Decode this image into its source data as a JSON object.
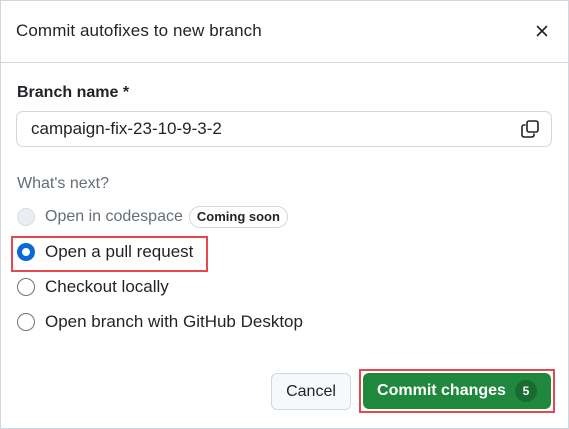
{
  "dialog": {
    "title": "Commit autofixes to new branch",
    "close_icon": "close-icon"
  },
  "branch": {
    "label": "Branch name *",
    "value": "campaign-fix-23-10-9-3-2",
    "copy_icon": "copy-icon"
  },
  "next": {
    "label": "What's next?",
    "options": [
      {
        "label": "Open in codespace",
        "badge": "Coming soon",
        "state": "disabled"
      },
      {
        "label": "Open a pull request",
        "state": "checked"
      },
      {
        "label": "Checkout locally",
        "state": "unchecked"
      },
      {
        "label": "Open branch with GitHub Desktop",
        "state": "unchecked"
      }
    ]
  },
  "footer": {
    "cancel_label": "Cancel",
    "commit_label": "Commit changes",
    "commit_count": "5"
  },
  "colors": {
    "accent_blue": "#0969da",
    "primary_green": "#1f883d",
    "highlight_red": "#e5484d",
    "border_gray": "#d0d7de"
  }
}
